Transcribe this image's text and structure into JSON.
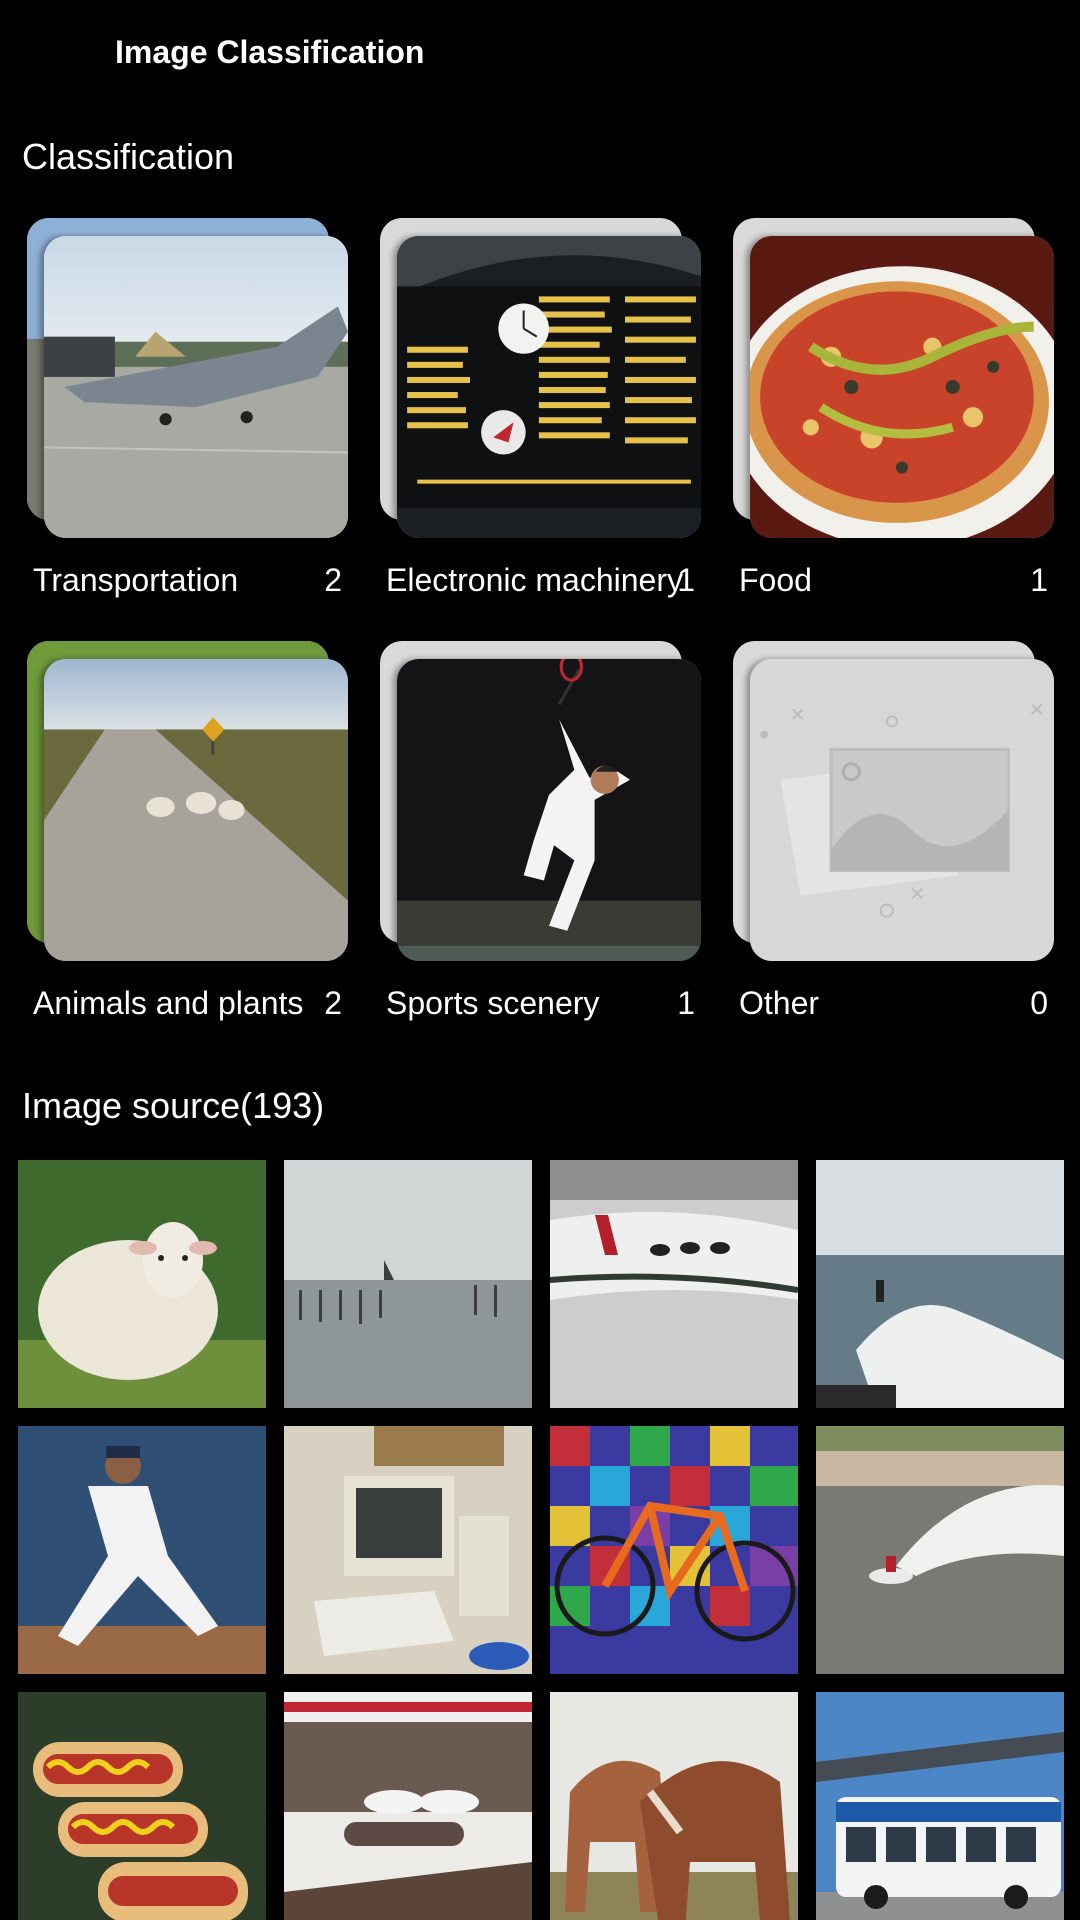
{
  "appbar": {
    "title": "Image Classification"
  },
  "classification": {
    "heading": "Classification",
    "categories": [
      {
        "name": "Transportation",
        "count": "2",
        "image": "jet-photo"
      },
      {
        "name": "Electronic machinery",
        "count": "1",
        "image": "departure-board-photo"
      },
      {
        "name": "Food",
        "count": "1",
        "image": "pizza-photo"
      },
      {
        "name": "Animals and plants",
        "count": "2",
        "image": "sheep-road-photo"
      },
      {
        "name": "Sports scenery",
        "count": "1",
        "image": "tennis-player-photo"
      },
      {
        "name": "Other",
        "count": "0",
        "image": "image-placeholder-icon"
      }
    ]
  },
  "source": {
    "heading": "Image source(193)",
    "thumbnails": [
      "sheep-photo",
      "lake-pier-photo",
      "airplane-interior-photo",
      "surfer-photo",
      "baseball-pitcher-photo",
      "computer-desk-photo",
      "bicycle-photo",
      "jetski-photo",
      "hotdogs-photo",
      "bedroom-photo",
      "horses-photo",
      "bus-photo"
    ]
  }
}
